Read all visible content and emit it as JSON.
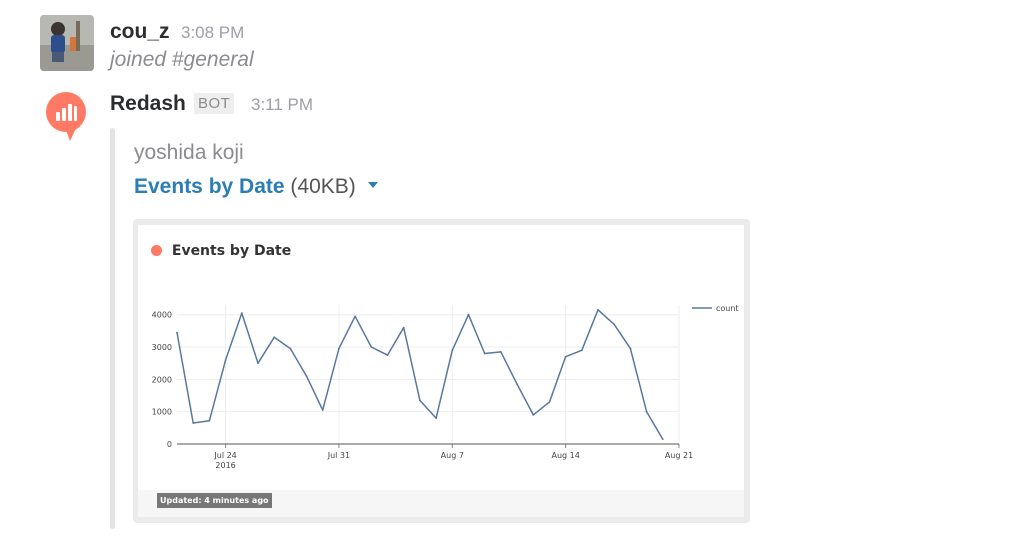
{
  "messages": [
    {
      "author": "cou_z",
      "time": "3:08 PM",
      "text": "joined #general"
    },
    {
      "author": "Redash",
      "badge": "BOT",
      "time": "3:11 PM"
    }
  ],
  "attachment": {
    "author_name": "yoshida koji",
    "title": "Events by Date",
    "size": "(40KB)",
    "preview": {
      "header": "Events by Date",
      "updated": "Updated: 4 minutes ago"
    }
  },
  "chart_data": {
    "type": "line",
    "title": "Events by Date",
    "xlabel": "",
    "ylabel": "",
    "x": [
      "2016-07-21",
      "2016-07-22",
      "2016-07-23",
      "2016-07-24",
      "2016-07-25",
      "2016-07-26",
      "2016-07-27",
      "2016-07-28",
      "2016-07-29",
      "2016-07-30",
      "2016-07-31",
      "2016-08-01",
      "2016-08-02",
      "2016-08-03",
      "2016-08-04",
      "2016-08-05",
      "2016-08-06",
      "2016-08-07",
      "2016-08-08",
      "2016-08-09",
      "2016-08-10",
      "2016-08-11",
      "2016-08-12",
      "2016-08-13",
      "2016-08-14",
      "2016-08-15",
      "2016-08-16",
      "2016-08-17",
      "2016-08-18",
      "2016-08-19",
      "2016-08-20",
      "2016-08-21"
    ],
    "series": [
      {
        "name": "count",
        "color": "#5878a0",
        "values": [
          3450,
          650,
          720,
          2600,
          4050,
          2500,
          3300,
          2950,
          2100,
          1050,
          2950,
          3950,
          3000,
          2750,
          3600,
          1350,
          800,
          2900,
          4000,
          2800,
          2850,
          1850,
          900,
          1300,
          2700,
          2900,
          4150,
          3700,
          2950,
          1000,
          150
        ]
      }
    ],
    "ylim": [
      0,
      4300
    ],
    "yticks": [
      0,
      1000,
      2000,
      3000,
      4000
    ],
    "xticks": [
      {
        "label": "Jul 24",
        "sublabel": "2016",
        "index": 3
      },
      {
        "label": "Jul 31",
        "index": 10
      },
      {
        "label": "Aug 7",
        "index": 17
      },
      {
        "label": "Aug 14",
        "index": 24
      },
      {
        "label": "Aug 21",
        "index": 31
      }
    ],
    "legend_position": "top-right",
    "grid": true
  }
}
